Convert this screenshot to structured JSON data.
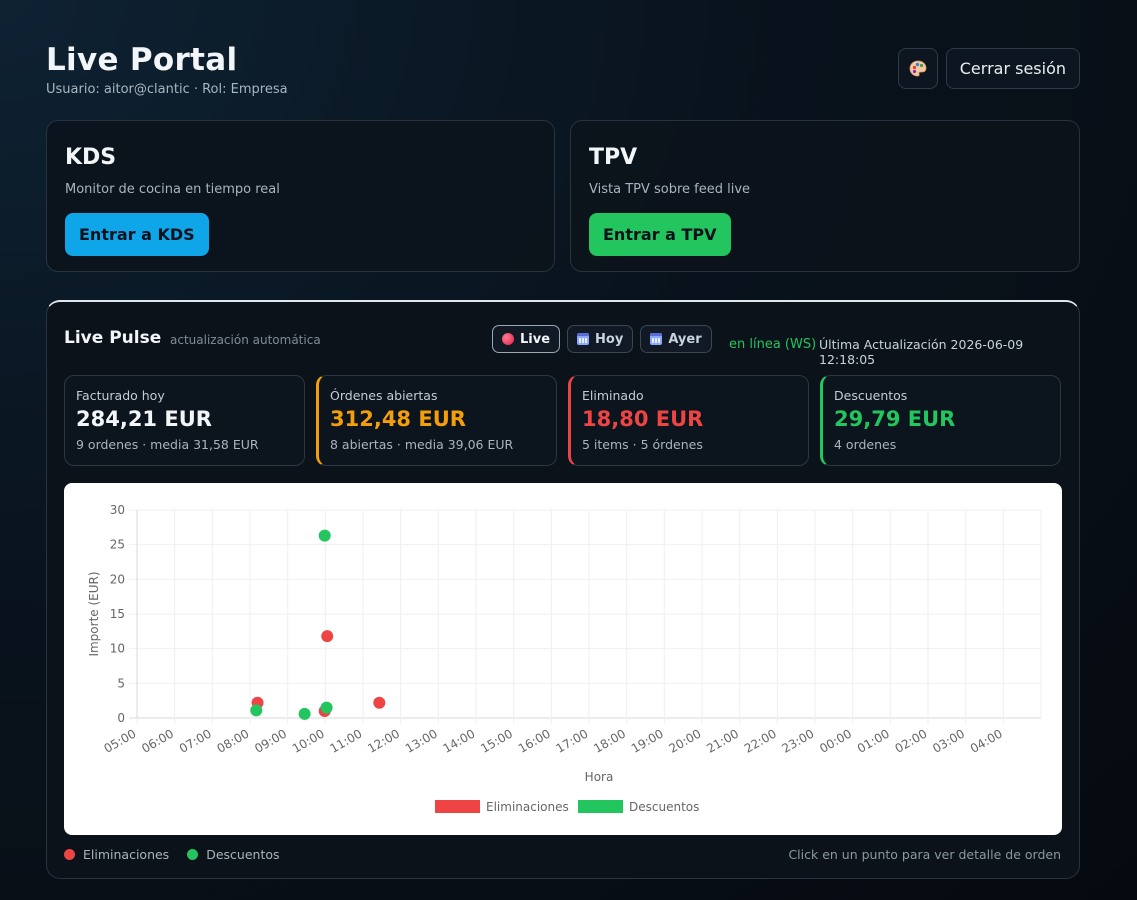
{
  "header": {
    "title": "Live Portal",
    "user_line": "Usuario: aitor@clantic · Rol: Empresa",
    "theme_icon": "palette-icon",
    "logout_label": "Cerrar sesión"
  },
  "cards": {
    "kds": {
      "title": "KDS",
      "description": "Monitor de cocina en tiempo real",
      "button": "Entrar a KDS"
    },
    "tpv": {
      "title": "TPV",
      "description": "Vista TPV sobre feed live",
      "button": "Entrar a TPV"
    }
  },
  "pulse": {
    "title": "Live Pulse",
    "subtitle": "actualización automática",
    "modes": [
      {
        "label": "Live",
        "icon": "live-dot-icon",
        "active": true
      },
      {
        "label": "Hoy",
        "icon": "calendar-icon",
        "active": false
      },
      {
        "label": "Ayer",
        "icon": "calendar-icon",
        "active": false
      }
    ],
    "connection": "en línea (WS)",
    "last_update": "Última Actualización 2026-06-09 12:18:05",
    "kpis": [
      {
        "label": "Facturado hoy",
        "value": "284,21 EUR",
        "sub": "9 ordenes · media 31,58 EUR"
      },
      {
        "label": "Órdenes abiertas",
        "value": "312,48 EUR",
        "sub": "8 abiertas · media 39,06 EUR"
      },
      {
        "label": "Eliminado",
        "value": "18,80 EUR",
        "sub": "5 items · 5 órdenes"
      },
      {
        "label": "Descuentos",
        "value": "29,79 EUR",
        "sub": "4 ordenes"
      }
    ],
    "legend": [
      {
        "label": "Eliminaciones",
        "color": "#ef4444"
      },
      {
        "label": "Descuentos",
        "color": "#22c55e"
      }
    ],
    "hint": "Click en un punto para ver detalle de orden"
  },
  "colors": {
    "red": "#ef4444",
    "green": "#22c55e",
    "amber": "#f59e0b",
    "blue": "#0ea5e9"
  },
  "chart_data": {
    "type": "scatter",
    "xlabel": "Hora",
    "ylabel": "Importe (EUR)",
    "ylim": [
      0,
      30
    ],
    "yticks": [
      0,
      5,
      10,
      15,
      20,
      25,
      30
    ],
    "x_ticks": [
      "05:00",
      "06:00",
      "07:00",
      "08:00",
      "09:00",
      "10:00",
      "11:00",
      "12:00",
      "13:00",
      "14:00",
      "15:00",
      "16:00",
      "17:00",
      "18:00",
      "19:00",
      "20:00",
      "21:00",
      "22:00",
      "23:00",
      "00:00",
      "01:00",
      "02:00",
      "03:00",
      "04:00"
    ],
    "legend_position": "bottom",
    "grid": true,
    "series": [
      {
        "name": "Eliminaciones",
        "color": "#ef4444",
        "points": [
          {
            "x": "08:12",
            "y": 2.2
          },
          {
            "x": "09:59",
            "y": 1.0
          },
          {
            "x": "10:03",
            "y": 11.8
          },
          {
            "x": "11:26",
            "y": 2.2
          }
        ]
      },
      {
        "name": "Descuentos",
        "color": "#22c55e",
        "points": [
          {
            "x": "08:10",
            "y": 1.1
          },
          {
            "x": "09:27",
            "y": 0.6
          },
          {
            "x": "09:59",
            "y": 26.3
          },
          {
            "x": "10:02",
            "y": 1.5
          }
        ]
      }
    ]
  }
}
